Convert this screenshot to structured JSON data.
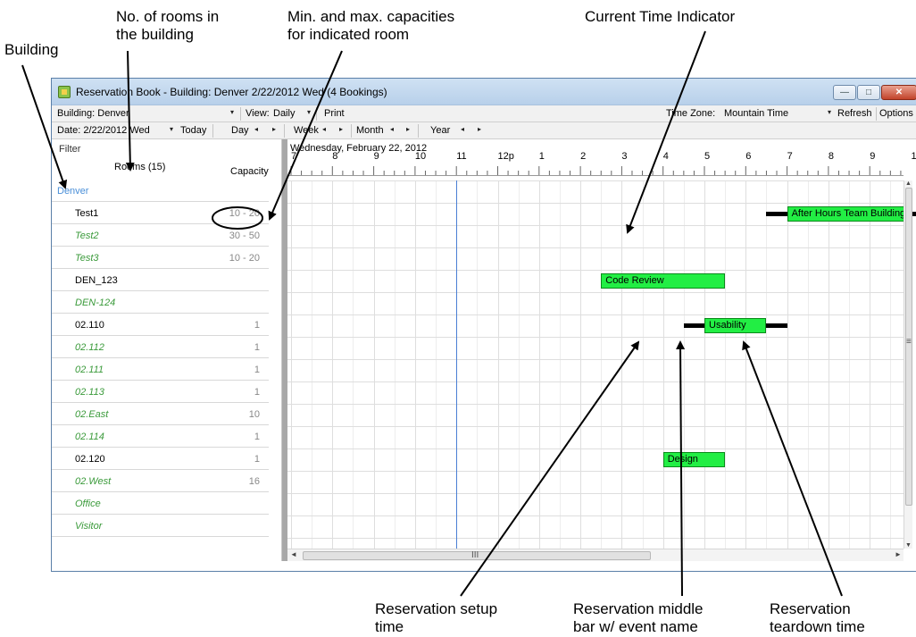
{
  "callouts": {
    "building": "Building",
    "room_count": "No. of rooms in\nthe building",
    "capacities": "Min. and max. capacities\nfor indicated room",
    "current_time": "Current Time Indicator",
    "setup": "Reservation setup\ntime",
    "middle": "Reservation middle\nbar w/ event name",
    "teardown": "Reservation\nteardown time"
  },
  "window": {
    "title": "Reservation Book - Building: Denver 2/22/2012 Wed (4 Bookings)",
    "minimize_glyph": "—",
    "maximize_glyph": "□",
    "close_glyph": "✕"
  },
  "toolbar": {
    "building": "Building: Denver",
    "view": "View:",
    "view_value": "Daily",
    "print": "Print",
    "time_zone_label": "Time Zone:",
    "time_zone_value": "Mountain Time",
    "refresh": "Refresh",
    "options": "Options",
    "date": "Date:  2/22/2012 Wed",
    "today": "Today",
    "day": "Day",
    "week": "Week",
    "month": "Month",
    "year": "Year",
    "dropdown_glyph": "▾",
    "prev_glyph": "◂",
    "next_glyph": "▸"
  },
  "left_panel": {
    "filter": "Filter",
    "rooms_header": "Rooms (15)",
    "capacity_header": "Capacity",
    "rows": [
      {
        "name": "Denver",
        "capacity": "",
        "style": "building"
      },
      {
        "name": "Test1",
        "capacity": "10 - 20",
        "style": "plain"
      },
      {
        "name": "Test2",
        "capacity": "30 - 50",
        "style": "alt"
      },
      {
        "name": "Test3",
        "capacity": "10 - 20",
        "style": "alt"
      },
      {
        "name": "DEN_123",
        "capacity": "",
        "style": "plain"
      },
      {
        "name": "DEN-124",
        "capacity": "",
        "style": "alt"
      },
      {
        "name": "02.110",
        "capacity": "1",
        "style": "plain"
      },
      {
        "name": "02.112",
        "capacity": "1",
        "style": "alt"
      },
      {
        "name": "02.111",
        "capacity": "1",
        "style": "alt"
      },
      {
        "name": "02.113",
        "capacity": "1",
        "style": "alt"
      },
      {
        "name": "02.East",
        "capacity": "10",
        "style": "alt"
      },
      {
        "name": "02.114",
        "capacity": "1",
        "style": "alt"
      },
      {
        "name": "02.120",
        "capacity": "1",
        "style": "plain"
      },
      {
        "name": "02.West",
        "capacity": "16",
        "style": "alt"
      },
      {
        "name": "Office",
        "capacity": "",
        "style": "alt"
      },
      {
        "name": "Visitor",
        "capacity": "",
        "style": "alt"
      }
    ]
  },
  "timeline": {
    "date": "Wednesday, February 22, 2012",
    "hours": [
      "7",
      "8",
      "9",
      "10",
      "11",
      "12p",
      "1",
      "2",
      "3",
      "4",
      "5",
      "6",
      "7",
      "8",
      "9",
      "1"
    ],
    "current_time_hour": 3.0
  },
  "events": [
    {
      "name": "After Hours Team Building",
      "row": 1,
      "setup_start": 5.5,
      "start": 6.0,
      "end": 9.0,
      "teardown_end": 9.5
    },
    {
      "name": "Code Review",
      "row": 4,
      "setup_start": 1.5,
      "start": 1.5,
      "end": 4.5,
      "teardown_end": 4.5
    },
    {
      "name": "Usability",
      "row": 6,
      "setup_start": 3.5,
      "start": 4.0,
      "end": 5.5,
      "teardown_end": 6.0
    },
    {
      "name": "Design",
      "row": 12,
      "setup_start": 3.0,
      "start": 3.0,
      "end": 4.5,
      "teardown_end": 4.5
    }
  ],
  "colors": {
    "event_fill": "#22ee44",
    "setup_teardown": "#000000",
    "current_time": "#4a7fd4",
    "building_text": "#4a8fd8",
    "alt_room_text": "#3a9a3a"
  },
  "scroll": {
    "up": "▲",
    "down": "▼",
    "left": "◄",
    "right": "►",
    "grip_h": "III",
    "grip_v": "≡"
  }
}
